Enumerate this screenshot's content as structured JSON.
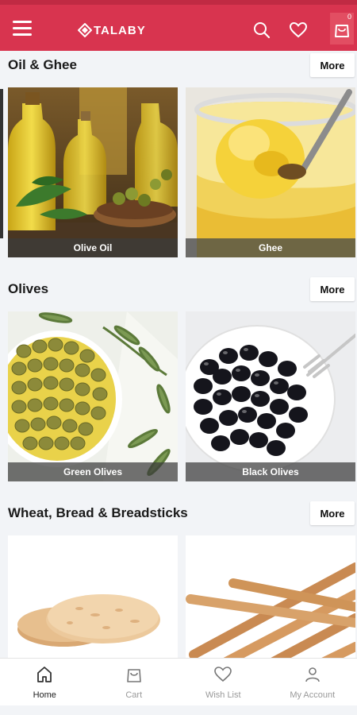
{
  "header": {
    "brand": "TALABY",
    "cart_count": "0",
    "colors": {
      "primary": "#d8344f",
      "accent": "#c02a43"
    }
  },
  "sections": [
    {
      "title": "Oil & Ghee",
      "more_label": "More",
      "items": [
        {
          "label": "Olive Oil"
        },
        {
          "label": "Ghee"
        }
      ]
    },
    {
      "title": "Olives",
      "more_label": "More",
      "items": [
        {
          "label": "Green Olives"
        },
        {
          "label": "Black Olives"
        }
      ]
    },
    {
      "title": "Wheat, Bread & Breadsticks",
      "more_label": "More",
      "items": [
        {
          "label": ""
        },
        {
          "label": ""
        }
      ]
    }
  ],
  "nav": {
    "items": [
      {
        "label": "Home",
        "icon": "home-icon",
        "active": true
      },
      {
        "label": "Cart",
        "icon": "cart-icon",
        "active": false
      },
      {
        "label": "Wish List",
        "icon": "heart-icon",
        "active": false
      },
      {
        "label": "My Account",
        "icon": "user-icon",
        "active": false
      }
    ]
  }
}
